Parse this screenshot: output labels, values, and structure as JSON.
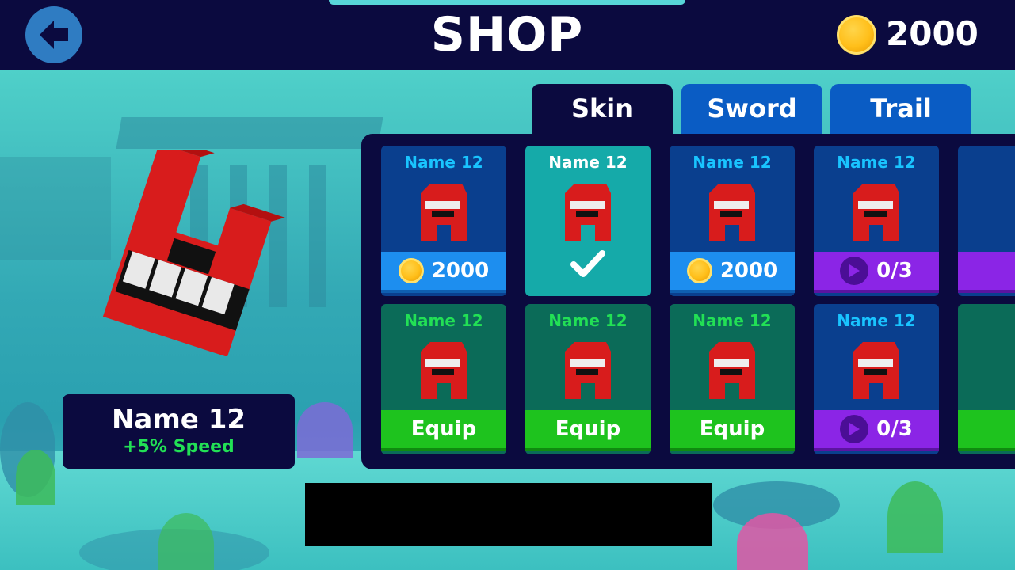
{
  "header": {
    "title": "SHOP",
    "coins": "2000",
    "back_icon": "arrow-left-icon"
  },
  "tabs": [
    {
      "label": "Skin",
      "active": true
    },
    {
      "label": "Sword",
      "active": false
    },
    {
      "label": "Trail",
      "active": false
    }
  ],
  "grid": {
    "row1": [
      {
        "name": "Name 12",
        "state": "price",
        "action": "2000"
      },
      {
        "name": "Name 12",
        "state": "selected",
        "action": ""
      },
      {
        "name": "Name 12",
        "state": "price",
        "action": "2000"
      },
      {
        "name": "Name 12",
        "state": "video",
        "action": "0/3"
      }
    ],
    "row2": [
      {
        "name": "Name 12",
        "state": "equip",
        "action": "Equip"
      },
      {
        "name": "Name 12",
        "state": "equip",
        "action": "Equip"
      },
      {
        "name": "Name 12",
        "state": "equip",
        "action": "Equip"
      },
      {
        "name": "Name 12",
        "state": "video",
        "action": "0/3"
      }
    ]
  },
  "selected_item": {
    "name": "Name 12",
    "stat": "+5% Speed"
  },
  "colors": {
    "panel": "#0b0a3f",
    "tab_inactive": "#0a5cc4",
    "price_button": "#1d8eef",
    "equip_button": "#1ec31e",
    "video_button": "#8b25e6",
    "selected_card": "#15aaa9"
  }
}
